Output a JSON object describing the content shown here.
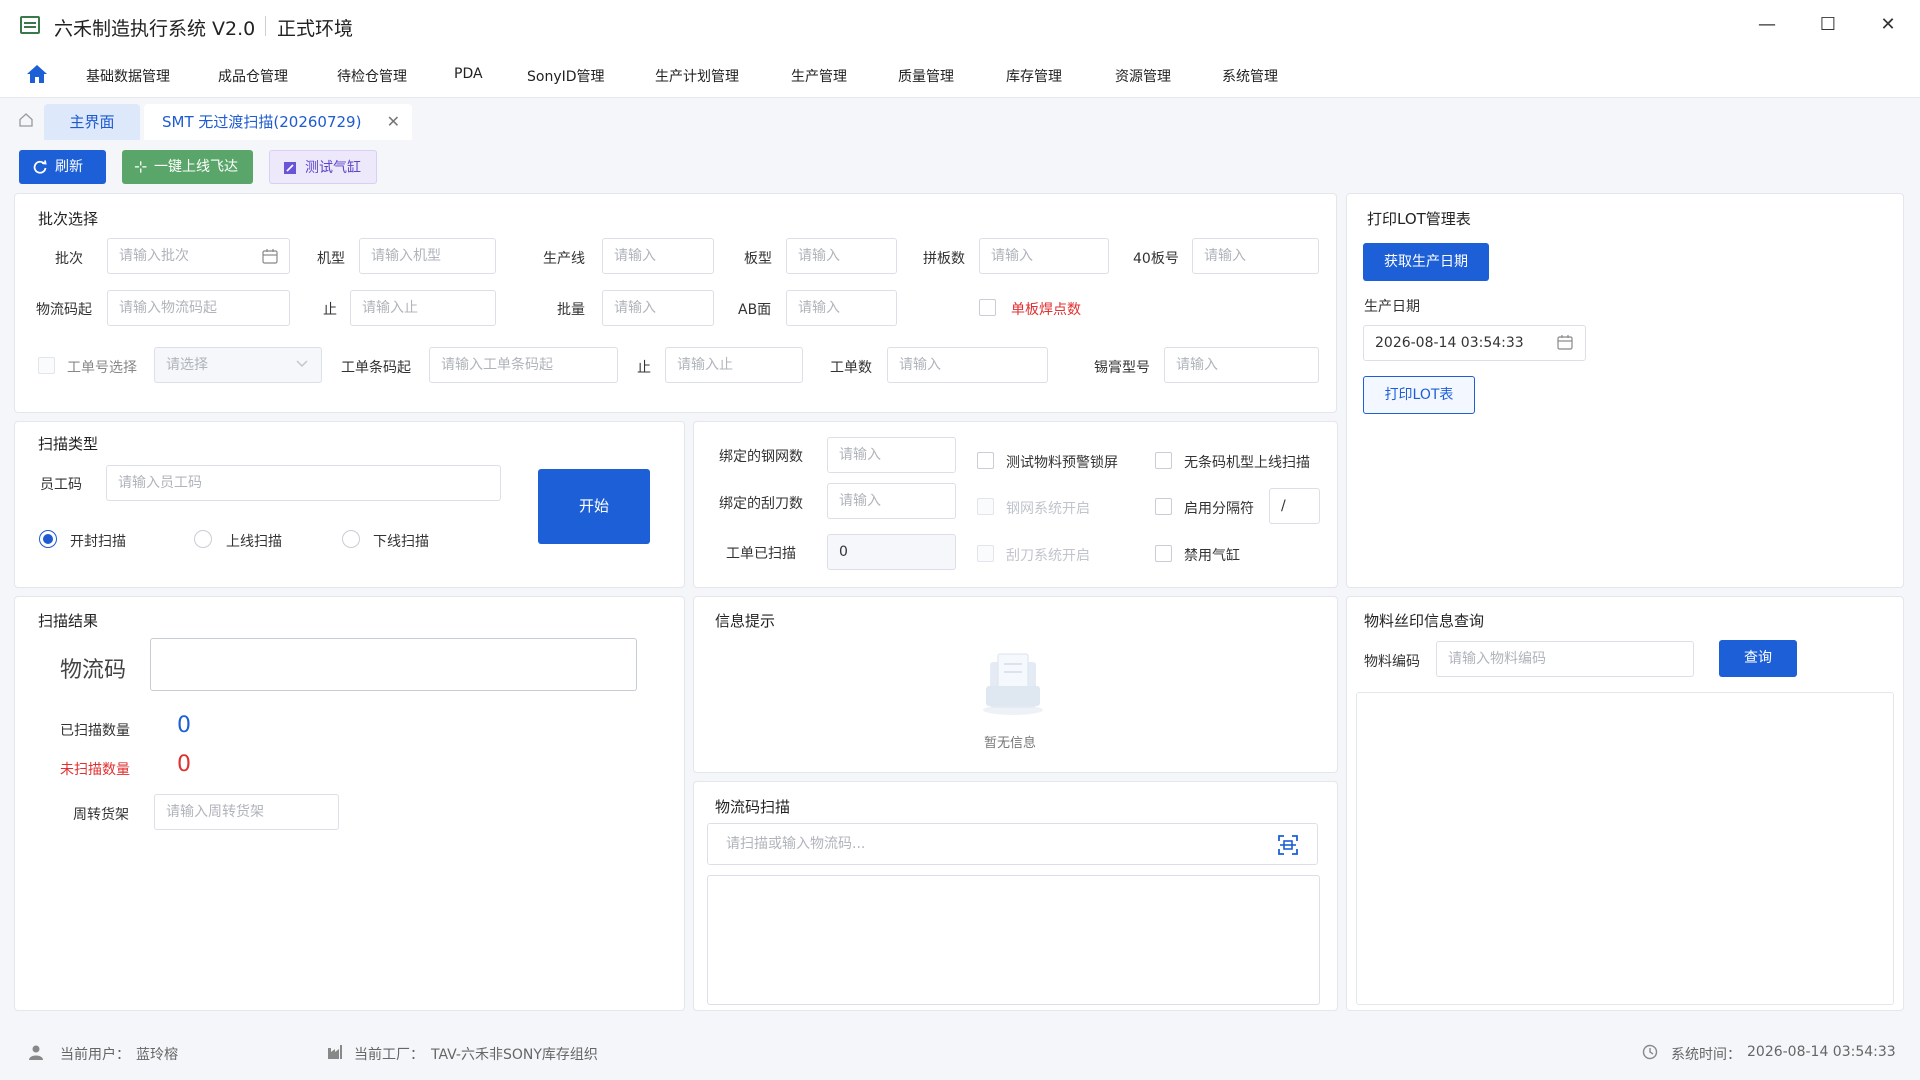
{
  "titlebar": {
    "title": "六禾制造执行系统 V2.0",
    "env": "正式环境",
    "minimize": "—",
    "maximize": "☐",
    "close": "✕"
  },
  "menu": {
    "items": [
      "基础数据管理",
      "成品仓管理",
      "待检仓管理",
      "PDA",
      "SonyID管理",
      "生产计划管理",
      "生产管理",
      "质量管理",
      "库存管理",
      "资源管理",
      "系统管理"
    ]
  },
  "tabs": {
    "home": "主界面",
    "active": "SMT 无过渡扫描(20260729)",
    "close": "✕"
  },
  "toolbar": {
    "refresh": "刷新",
    "online": "一键上线飞达",
    "test_cylinder": "测试气缸"
  },
  "batch": {
    "title": "批次选择",
    "batch_label": "批次",
    "batch_ph": "请输入批次",
    "model_label": "机型",
    "model_ph": "请输入机型",
    "line_label": "生产线",
    "line_ph": "请输入",
    "board_label": "板型",
    "board_ph": "请输入",
    "panel_label": "拼板数",
    "panel_ph": "请输入",
    "b40_label": "40板号",
    "b40_ph": "请输入",
    "lc_from_label": "物流码起",
    "lc_from_ph": "请输入物流码起",
    "lc_to_label": "止",
    "lc_to_ph": "请输入止",
    "qty_label": "批量",
    "qty_ph": "请输入",
    "ab_label": "AB面",
    "ab_ph": "请输入",
    "single_weld": "单板焊点数",
    "wo_select_label": "工单号选择",
    "wo_select_ph": "请选择",
    "wo_bar_label": "工单条码起",
    "wo_bar_ph": "请输入工单条码起",
    "wo_to_label": "止",
    "wo_to_ph": "请输入止",
    "wo_count_label": "工单数",
    "wo_count_ph": "请输入",
    "paste_label": "锡膏型号",
    "paste_ph": "请输入"
  },
  "print_lot": {
    "title": "打印LOT管理表",
    "get_date": "获取生产日期",
    "date_label": "生产日期",
    "date_value": "2026-08-14  03:54:33",
    "print": "打印LOT表"
  },
  "scan_type": {
    "title": "扫描类型",
    "emp_label": "员工码",
    "emp_ph": "请输入员工码",
    "start": "开始",
    "opt_open": "开封扫描",
    "opt_online": "上线扫描",
    "opt_offline": "下线扫描"
  },
  "bind": {
    "stencil_label": "绑定的钢网数",
    "stencil_ph": "请输入",
    "squeegee_label": "绑定的刮刀数",
    "squeegee_ph": "请输入",
    "wo_scanned_label": "工单已扫描",
    "wo_scanned_value": "0",
    "test_lock": "测试物料预警锁屏",
    "no_barcode": "无条码机型上线扫描",
    "stencil_sys": "钢网系统开启",
    "use_sep": "启用分隔符",
    "sep_value": "/",
    "squeegee_sys": "刮刀系统开启",
    "disable_cyl": "禁用气缸"
  },
  "result": {
    "title": "扫描结果",
    "lc_label": "物流码",
    "lc_value": "",
    "scanned_label": "已扫描数量",
    "scanned_value": "0",
    "unscanned_label": "未扫描数量",
    "unscanned_value": "0",
    "rack_label": "周转货架",
    "rack_ph": "请输入周转货架"
  },
  "info": {
    "title": "信息提示",
    "empty": "暂无信息"
  },
  "lc_scan": {
    "title": "物流码扫描",
    "ph": "请扫描或输入物流码..."
  },
  "silk": {
    "title": "物料丝印信息查询",
    "code_label": "物料编码",
    "code_ph": "请输入物料编码",
    "query": "查询"
  },
  "status": {
    "user_label": "当前用户：",
    "user": "蓝玲榕",
    "factory_label": "当前工厂：",
    "factory": "TAV-六禾非SONY库存组织",
    "time_label": "系统时间：",
    "time": "2026-08-14 03:54:33"
  },
  "colors": {
    "primary": "#1d5fd6",
    "green": "#5aa66a",
    "purple_bg": "#ede9fb",
    "danger": "#e03030"
  }
}
